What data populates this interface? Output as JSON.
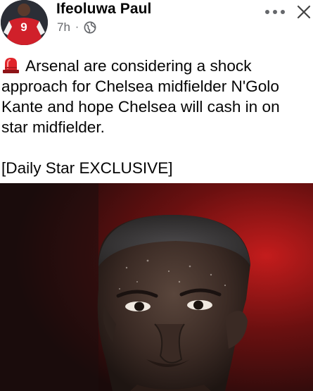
{
  "post": {
    "author": "Ifeoluwa Paul",
    "time": "7h",
    "separator": "·",
    "privacy_icon": "globe-icon",
    "more_icon": "more-horizontal-icon",
    "close_icon": "close-icon",
    "avatar_shirt_number": "9",
    "text_line1": "Arsenal are considering a shock",
    "text_rest": "approach for Chelsea midfielder N'Golo\nKante and hope Chelsea will cash in on\nstar midfielder.\n\n[Daily Star EXCLUSIVE]",
    "lead_icon": "siren-icon"
  },
  "colors": {
    "text": "#050505",
    "secondary_text": "#65676b",
    "siren": "#e0242a",
    "photo_dark": "#1a0c0c",
    "photo_red": "#b01818"
  }
}
